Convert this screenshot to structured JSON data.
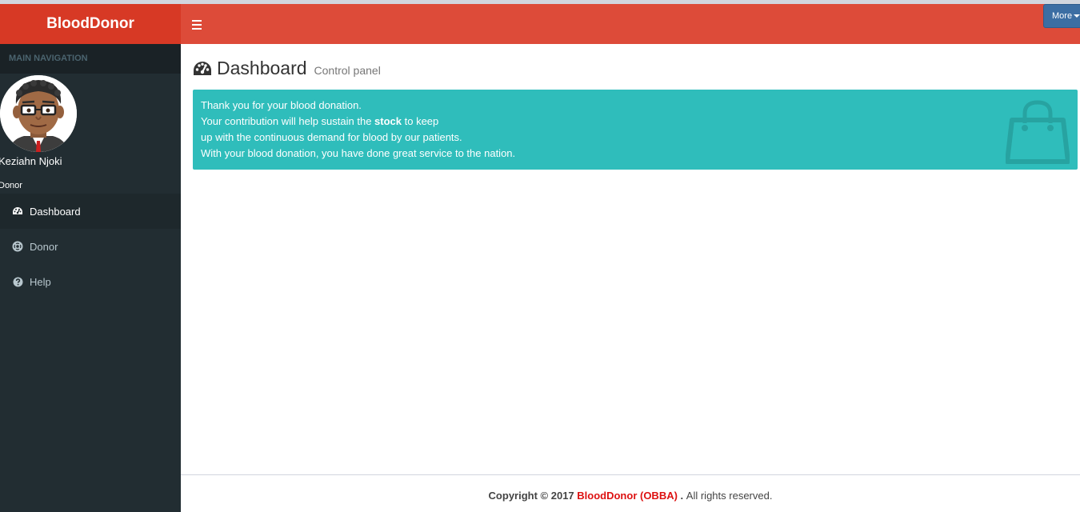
{
  "brand": "BloodDonor",
  "header": {
    "more_label": "More"
  },
  "sidebar": {
    "section_header": "MAIN NAVIGATION",
    "user": {
      "name": "Keziahn Njoki",
      "role": "Donor"
    },
    "items": [
      {
        "label": "Dashboard",
        "icon": "dashboard-icon",
        "active": true
      },
      {
        "label": "Donor",
        "icon": "life-ring-icon",
        "active": false
      },
      {
        "label": "Help",
        "icon": "question-circle-icon",
        "active": false
      }
    ]
  },
  "page": {
    "title": "Dashboard",
    "subtitle": "Control panel"
  },
  "callout": {
    "line1": "Thank you for your blood donation.",
    "line2_before": "Your contribution will help sustain the ",
    "line2_bold": "stock",
    "line2_after": " to keep",
    "line3": "up with the continuous demand for blood by our patients.",
    "line4": "With your blood donation, you have done great service to the nation."
  },
  "footer": {
    "copyright": "Copyright © 2017",
    "brand": "BloodDonor (OBBA)",
    "dot": ".",
    "rights": "All rights reserved."
  },
  "colors": {
    "header_red": "#dd4b39",
    "logo_red": "#d73925",
    "sidebar_dark": "#222d32",
    "callout_teal": "#2fbdbb",
    "more_button_blue": "#3c6ea3"
  }
}
